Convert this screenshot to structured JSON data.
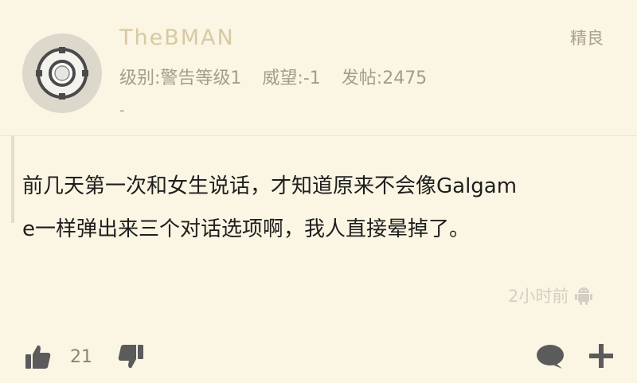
{
  "user": {
    "name": "TheBMAN",
    "level": "级别:警告等级1",
    "prestige": "威望:-1",
    "posts": "发帖:2475",
    "signature": "-",
    "badge": "精良"
  },
  "post": {
    "line1": "前几天第一次和女生说话，才知道原来不会像Galgam",
    "line2": "e一样弹出来三个对话选项啊，我人直接晕掉了。",
    "time": "2小时前",
    "device_icon": "android-icon"
  },
  "actions": {
    "like_count": "21"
  },
  "colors": {
    "background": "#fbf5e3",
    "username": "#d8c9a4",
    "meta": "#a49d8d",
    "icon": "#5b5b5b"
  }
}
